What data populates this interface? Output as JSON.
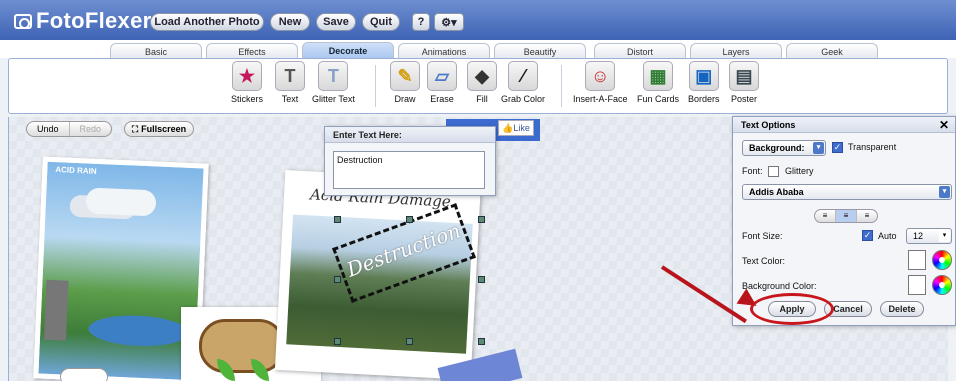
{
  "header": {
    "logo": "FotoFlexer",
    "buttons": {
      "load": "Load Another Photo",
      "new": "New",
      "save": "Save",
      "quit": "Quit",
      "help": "?",
      "settings": "⚙▾"
    }
  },
  "tabs": [
    "Basic",
    "Effects",
    "Decorate",
    "Animations",
    "Beautify",
    "Distort",
    "Layers",
    "Geek"
  ],
  "active_tab": "Decorate",
  "tools": [
    "Stickers",
    "Text",
    "Glitter Text",
    "Draw",
    "Erase",
    "Fill",
    "Grab Color",
    "Insert-A-Face",
    "Fun Cards",
    "Borders",
    "Poster"
  ],
  "canvas": {
    "undo": "Undo",
    "redo": "Redo",
    "fullscreen": "Fullscreen",
    "like": "Like",
    "photo1_caption": "ACID RAIN",
    "photo2_title": "Acid Rain Damage",
    "canvas_text": "Destruction"
  },
  "enter_text": {
    "header": "Enter Text Here:",
    "value": "Destruction"
  },
  "text_options": {
    "title": "Text Options",
    "close": "✕",
    "background_label": "Background:",
    "transparent_label": "Transparent",
    "font_label": "Font:",
    "glittery_label": "Glittery",
    "font_value": "Addis Ababa",
    "font_size_label": "Font Size:",
    "auto_label": "Auto",
    "font_size_value": "12",
    "text_color_label": "Text Color:",
    "background_color_label": "Background Color:",
    "apply": "Apply",
    "cancel": "Cancel",
    "delete": "Delete"
  },
  "colors": {
    "header": "#3f63b5",
    "accent": "#c8161d",
    "active_tab": "#a9c6ef"
  }
}
